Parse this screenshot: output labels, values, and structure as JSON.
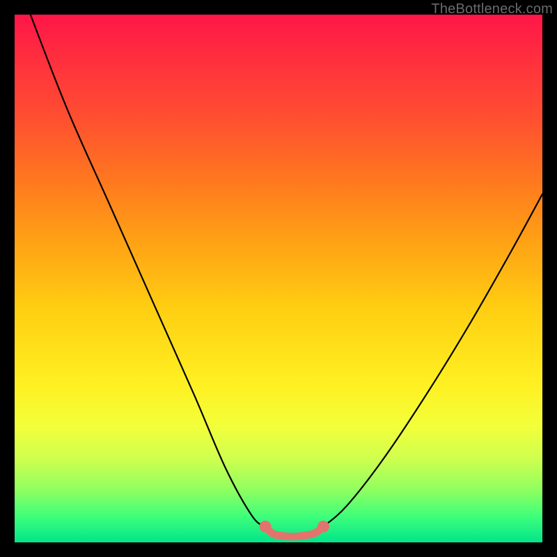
{
  "watermark": "TheBottleneck.com",
  "chart_data": {
    "type": "line",
    "title": "",
    "xlabel": "",
    "ylabel": "",
    "xlim": [
      0,
      100
    ],
    "ylim": [
      0,
      100
    ],
    "grid": false,
    "legend": false,
    "series": [
      {
        "name": "left-branch",
        "color": "#000000",
        "x": [
          3,
          10,
          18,
          26,
          34,
          40,
          45,
          47.5
        ],
        "y": [
          100,
          82,
          64,
          46,
          28,
          14,
          5,
          3
        ]
      },
      {
        "name": "valley-floor",
        "color": "#e2746d",
        "x": [
          47.5,
          49,
          51,
          53,
          55,
          57,
          58.5
        ],
        "y": [
          3,
          1.6,
          1.2,
          1.1,
          1.3,
          1.8,
          3
        ]
      },
      {
        "name": "right-branch",
        "color": "#000000",
        "x": [
          58.5,
          63,
          70,
          78,
          86,
          94,
          100
        ],
        "y": [
          3,
          7,
          16,
          28,
          41,
          55,
          66
        ]
      }
    ],
    "markers": [
      {
        "name": "valley-left-endpoint",
        "x": 47.5,
        "y": 3,
        "color": "#e2746d"
      },
      {
        "name": "valley-right-endpoint",
        "x": 58.5,
        "y": 3,
        "color": "#e2746d"
      }
    ]
  }
}
